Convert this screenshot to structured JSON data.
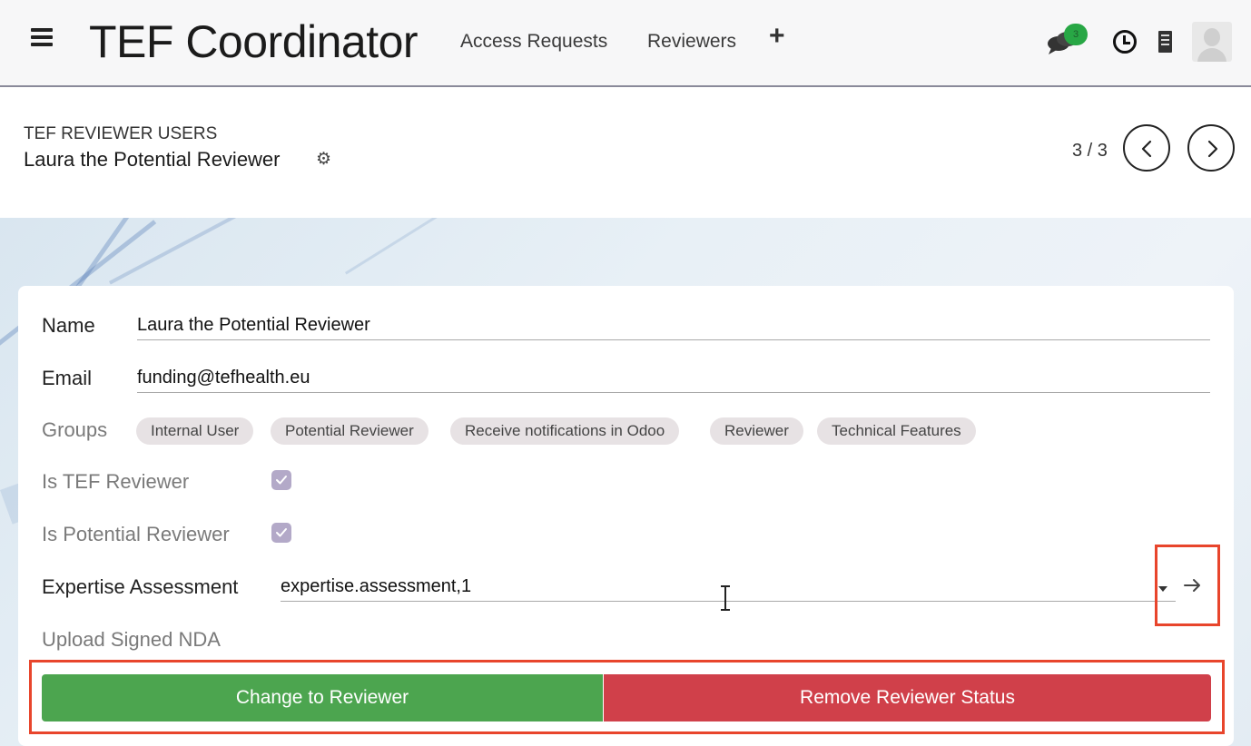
{
  "navbar": {
    "app_title": "TEF Coordinator",
    "menu": [
      {
        "label": "Access Requests"
      },
      {
        "label": "Reviewers"
      },
      {
        "label": "+"
      }
    ],
    "chat_badge_count": "3",
    "icons": [
      "menu-icon",
      "chat-icon",
      "clock-icon",
      "building-icon",
      "avatar"
    ]
  },
  "control_panel": {
    "breadcrumb": "TEF REVIEWER USERS",
    "record_title": "Laura the Potential Reviewer",
    "pager": "3 / 3"
  },
  "form": {
    "name": {
      "label": "Name",
      "value": "Laura the Potential Reviewer"
    },
    "email": {
      "label": "Email",
      "value": "funding@tefhealth.eu"
    },
    "groups": {
      "label": "Groups",
      "tags": [
        "Internal User",
        "Potential Reviewer",
        "Receive notifications in Odoo",
        "Reviewer",
        "Technical Features"
      ]
    },
    "is_tef_reviewer": {
      "label": "Is TEF Reviewer",
      "checked": true
    },
    "is_potential_reviewer": {
      "label": "Is Potential Reviewer",
      "checked": true
    },
    "expertise_assessment": {
      "label": "Expertise Assessment",
      "value": "expertise.assessment,1"
    },
    "upload_nda": {
      "label": "Upload Signed NDA"
    }
  },
  "actions": {
    "change_to_reviewer": "Change to Reviewer",
    "remove_reviewer_status": "Remove Reviewer Status"
  },
  "colors": {
    "primary_green": "#4ca54f",
    "danger_red": "#d0404a",
    "highlight": "#e8452c",
    "checkbox": "#b3a9c8"
  }
}
